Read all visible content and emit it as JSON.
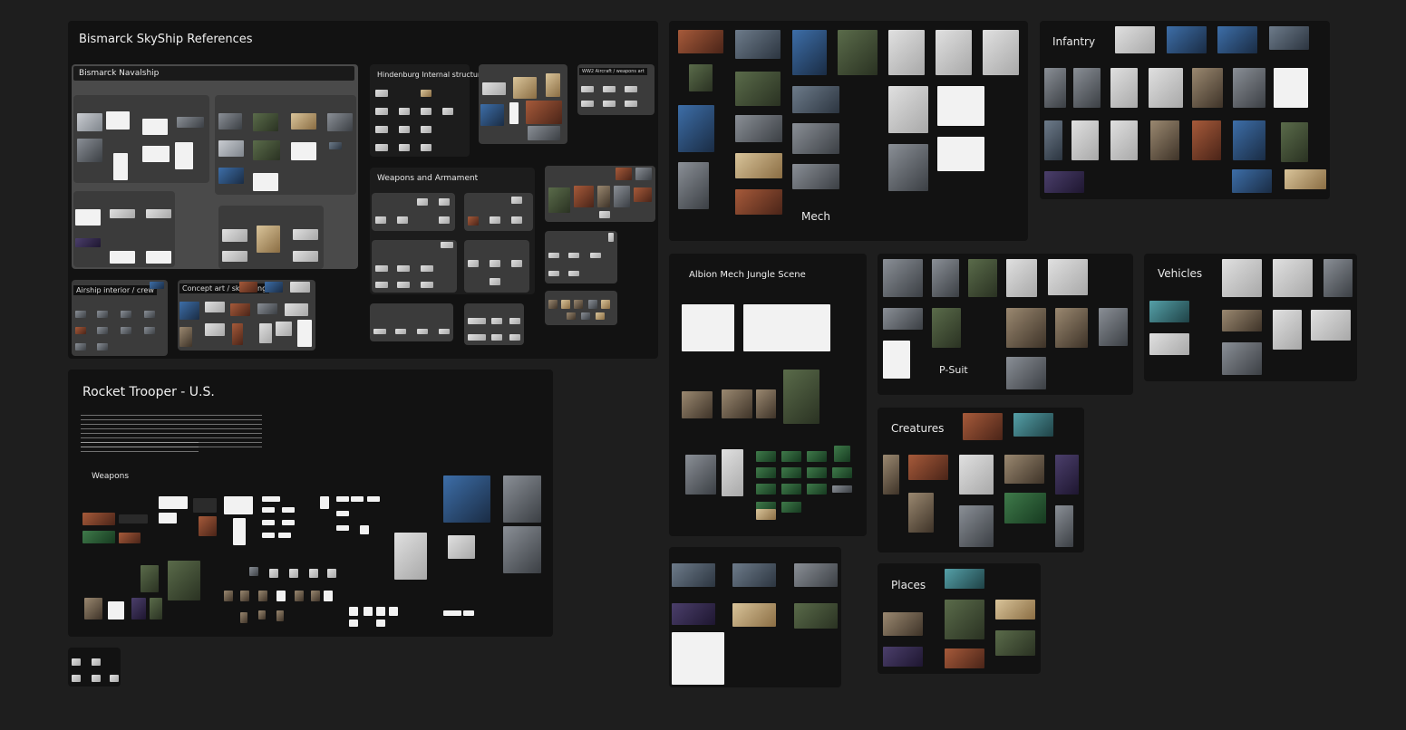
{
  "boards": {
    "bismarck": {
      "title": "Bismarck SkyShip References",
      "naval_title": "Bismarck Navalship",
      "hindenburg": "Hindenburg Internal structure",
      "weapons_armament": "Weapons and Armament",
      "airship_interior": "Airship interior / crew",
      "concept": "Concept art / sketching",
      "ww2_art": "WW2 Aircraft / weapons art"
    },
    "mech": {
      "title": "Mech"
    },
    "infantry": {
      "title": "Infantry"
    },
    "rocket": {
      "title": "Rocket Trooper - U.S.",
      "weapons": "Weapons"
    },
    "albion": {
      "title": "Albion Mech Jungle Scene"
    },
    "psuit": {
      "title": "P-Suit"
    },
    "vehicles": {
      "title": "Vehicles"
    },
    "creatures": {
      "title": "Creatures"
    },
    "places": {
      "title": "Places"
    }
  },
  "colors": {
    "background": "#1e1e1e",
    "board": "#121212",
    "group": "#4a4a4a"
  }
}
